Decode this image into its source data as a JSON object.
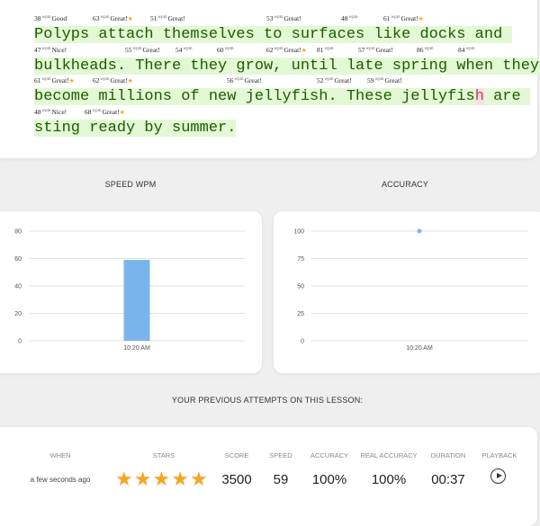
{
  "lesson": {
    "rows": [
      {
        "annotations": [
          {
            "wpm": "38",
            "unit": "wpm",
            "label": "Good",
            "star": false
          },
          {
            "wpm": "63",
            "unit": "wpm",
            "label": "Great!",
            "star": true
          },
          {
            "wpm": "51",
            "unit": "wpm",
            "label": "Great!",
            "star": false
          },
          {
            "wpm": "53",
            "unit": "wpm",
            "label": "Great!",
            "star": false
          },
          {
            "wpm": "48",
            "unit": "wpm",
            "label": "",
            "star": false
          },
          {
            "wpm": "61",
            "unit": "wpm",
            "label": "Great!",
            "star": true
          }
        ],
        "text": "Polyps attach themselves to surfaces like docks and "
      },
      {
        "annotations": [
          {
            "wpm": "47",
            "unit": "wpm",
            "label": "Nice!",
            "star": false
          },
          {
            "wpm": "55",
            "unit": "wpm",
            "label": "Great!",
            "star": false
          },
          {
            "wpm": "54",
            "unit": "wpm",
            "label": "",
            "star": false
          },
          {
            "wpm": "60",
            "unit": "wpm",
            "label": "",
            "star": false
          },
          {
            "wpm": "62",
            "unit": "wpm",
            "label": "Great!",
            "star": true
          },
          {
            "wpm": "81",
            "unit": "wpm",
            "label": "",
            "star": false
          },
          {
            "wpm": "57",
            "unit": "wpm",
            "label": "Great!",
            "star": false
          },
          {
            "wpm": "86",
            "unit": "wpm",
            "label": "",
            "star": false
          },
          {
            "wpm": "84",
            "unit": "wpm",
            "label": "",
            "star": false
          }
        ],
        "text": "bulkheads. There they grow, until late spring when they"
      },
      {
        "annotations": [
          {
            "wpm": "61",
            "unit": "wpm",
            "label": "Great!",
            "star": true
          },
          {
            "wpm": "62",
            "unit": "wpm",
            "label": "Great!",
            "star": true
          },
          {
            "wpm": "56",
            "unit": "wpm",
            "label": "Great!",
            "star": false
          },
          {
            "wpm": "52",
            "unit": "wpm",
            "label": "Great!",
            "star": false
          },
          {
            "wpm": "59",
            "unit": "wpm",
            "label": "Great!",
            "star": false
          }
        ],
        "text_before_error": "become millions of new jellyfish. These jellyfis",
        "error_char": "h",
        "text_after_error": " are "
      },
      {
        "annotations": [
          {
            "wpm": "48",
            "unit": "wpm",
            "label": "Nice!",
            "star": false
          },
          {
            "wpm": "68",
            "unit": "wpm",
            "label": "Great!",
            "star": true
          }
        ],
        "text": "sting ready by summer."
      }
    ]
  },
  "speed_title": "SPEED WPM",
  "accuracy_title": "ACCURACY",
  "chart_data": [
    {
      "type": "bar",
      "title": "SPEED WPM",
      "categories": [
        "10:20 AM"
      ],
      "values": [
        59
      ],
      "ylim": [
        0,
        80
      ],
      "yticks": [
        0,
        20,
        40,
        60,
        80
      ],
      "color": "#7ab4ec",
      "grid": true
    },
    {
      "type": "scatter",
      "title": "ACCURACY",
      "x": [
        "10:20 AM"
      ],
      "values": [
        100
      ],
      "ylim": [
        0,
        100
      ],
      "yticks": [
        0,
        25,
        50,
        75,
        100
      ],
      "color": "#7ab4ec",
      "grid": true
    }
  ],
  "attempts": {
    "heading": "YOUR PREVIOUS ATTEMPTS ON THIS LESSON:",
    "headers": {
      "when": "WHEN",
      "stars": "STARS",
      "score": "SCORE",
      "speed": "SPEED",
      "accuracy": "ACCURACY",
      "real_accuracy": "REAL ACCURACY",
      "duration": "DURATION",
      "playback": "PLAYBACK"
    },
    "row": {
      "when": "a few seconds ago",
      "stars": 5,
      "score": "3500",
      "speed": "59",
      "accuracy": "100%",
      "real_accuracy": "100%",
      "duration": "00:37",
      "playback_icon": "play-icon"
    }
  },
  "colors": {
    "typed_highlight": "#e3f8d4",
    "typed_text": "#1a5c00",
    "error_highlight": "#fde0e4",
    "bar": "#7ab4ec",
    "star": "#f5a623"
  }
}
